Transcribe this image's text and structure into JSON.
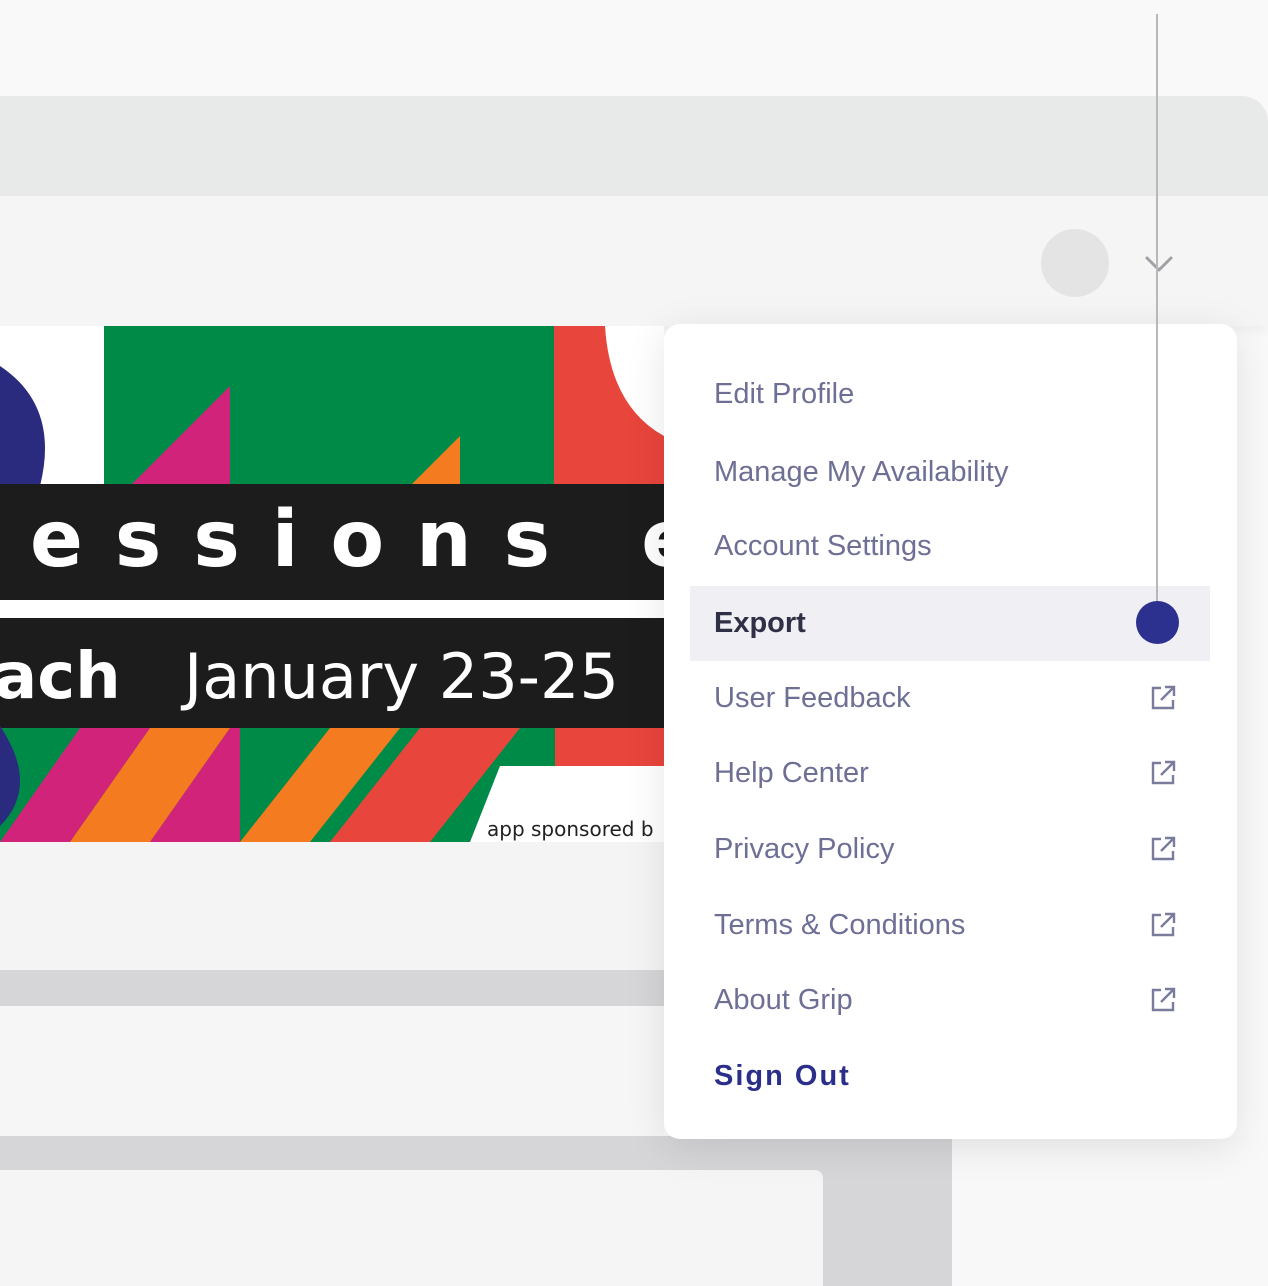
{
  "header": {
    "avatar_label": "user avatar",
    "chevron_icon": "chevron-down-icon"
  },
  "banner": {
    "line1": "essions e",
    "line2_left": "ach",
    "line2_right": "January 23-25",
    "sponsor": "app sponsored b"
  },
  "menu": {
    "items": [
      {
        "label": "Edit Profile",
        "external": false
      },
      {
        "label": "Manage My Availability",
        "external": false
      },
      {
        "label": "Account Settings",
        "external": false
      },
      {
        "label": "Export",
        "external": false,
        "active": true
      },
      {
        "label": "User Feedback",
        "external": true
      },
      {
        "label": "Help Center",
        "external": true
      },
      {
        "label": "Privacy Policy",
        "external": true
      },
      {
        "label": "Terms & Conditions",
        "external": true
      },
      {
        "label": "About Grip",
        "external": true
      },
      {
        "label": "Sign Out",
        "external": false
      }
    ],
    "external_icon": "external-link-icon"
  },
  "colors": {
    "accent": "#2c3190",
    "menu_text": "#6d6f95",
    "active_bg": "#efeff4"
  }
}
